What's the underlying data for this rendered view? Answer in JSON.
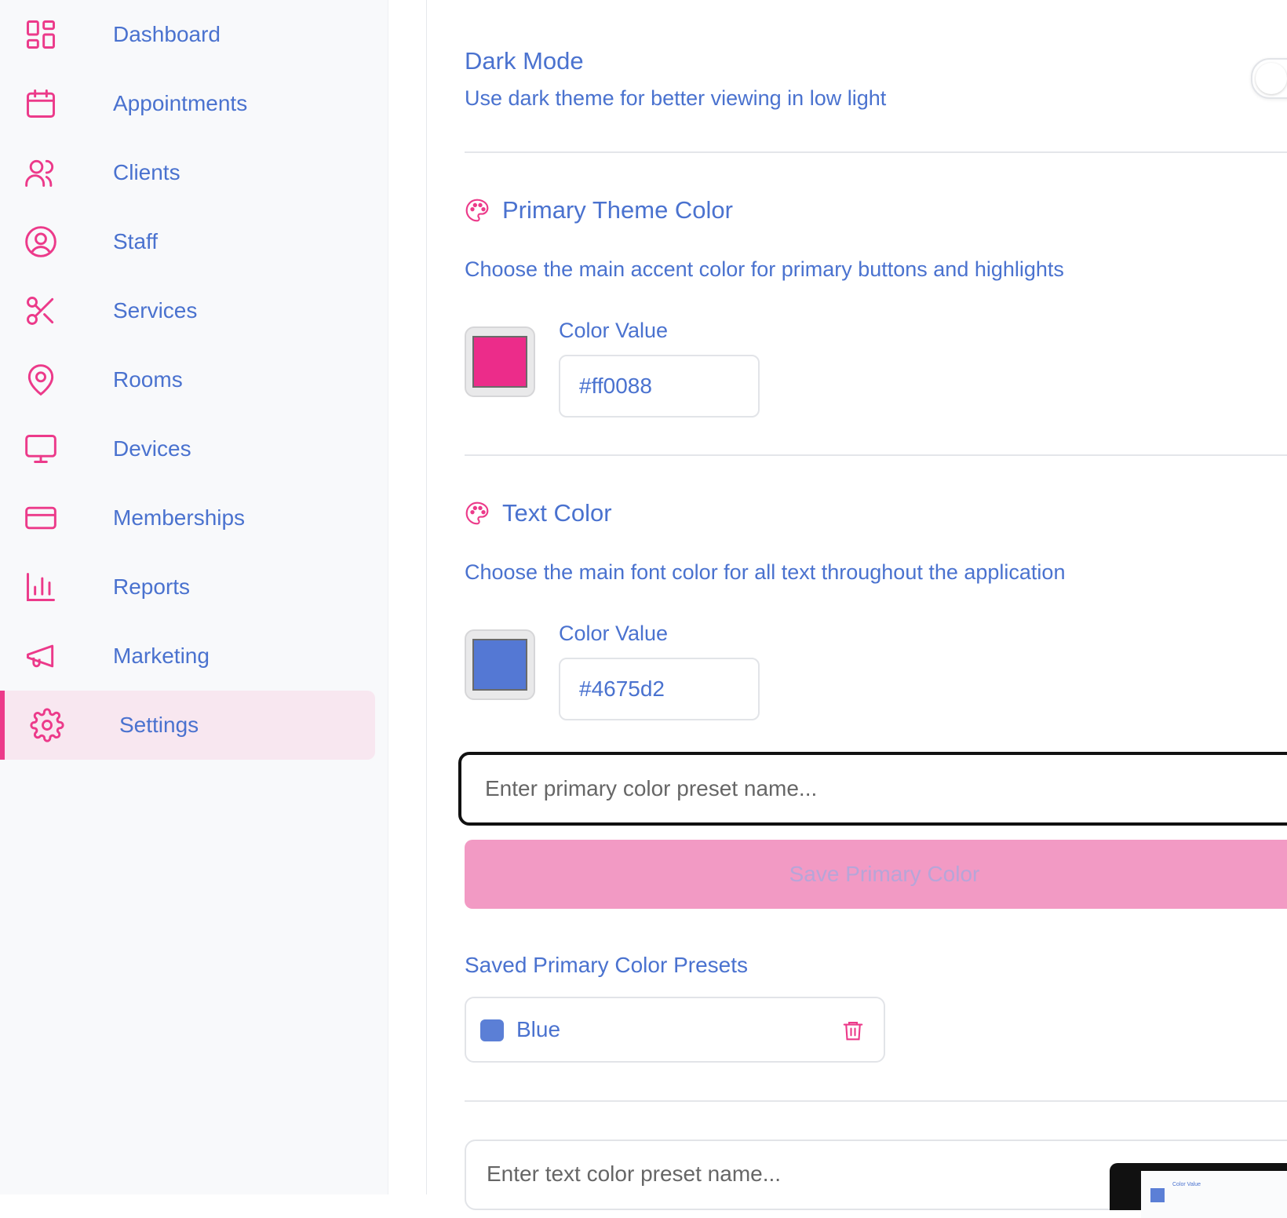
{
  "sidebar": {
    "items": [
      {
        "label": "Dashboard",
        "icon": "dashboard-icon"
      },
      {
        "label": "Appointments",
        "icon": "calendar-icon"
      },
      {
        "label": "Clients",
        "icon": "users-icon"
      },
      {
        "label": "Staff",
        "icon": "user-circle-icon"
      },
      {
        "label": "Services",
        "icon": "scissors-icon"
      },
      {
        "label": "Rooms",
        "icon": "map-pin-icon"
      },
      {
        "label": "Devices",
        "icon": "monitor-icon"
      },
      {
        "label": "Memberships",
        "icon": "credit-card-icon"
      },
      {
        "label": "Reports",
        "icon": "bar-chart-icon"
      },
      {
        "label": "Marketing",
        "icon": "megaphone-icon"
      },
      {
        "label": "Settings",
        "icon": "gear-icon"
      }
    ],
    "active": "Settings"
  },
  "dark_mode": {
    "title": "Dark Mode",
    "description": "Use dark theme for better viewing in low light",
    "enabled": false
  },
  "primary_color": {
    "title": "Primary Theme Color",
    "description": "Choose the main accent color for primary buttons and highlights",
    "value_label": "Color Value",
    "value": "#ff0088",
    "swatch": "#ec2c8a"
  },
  "text_color": {
    "title": "Text Color",
    "description": "Choose the main font color for all text throughout the application",
    "value_label": "Color Value",
    "value": "#4675d2",
    "swatch": "#5478d4"
  },
  "primary_preset": {
    "placeholder": "Enter primary color preset name...",
    "save_label": "Save Primary Color"
  },
  "saved_presets": {
    "title": "Saved Primary Color Presets",
    "items": [
      {
        "name": "Blue",
        "color": "#5b7fd6"
      }
    ]
  },
  "text_preset": {
    "placeholder": "Enter text color preset name..."
  },
  "thumbnail": {
    "label": "Color Value"
  },
  "colors": {
    "accent": "#ec3a8a",
    "text": "#4a72cf"
  }
}
